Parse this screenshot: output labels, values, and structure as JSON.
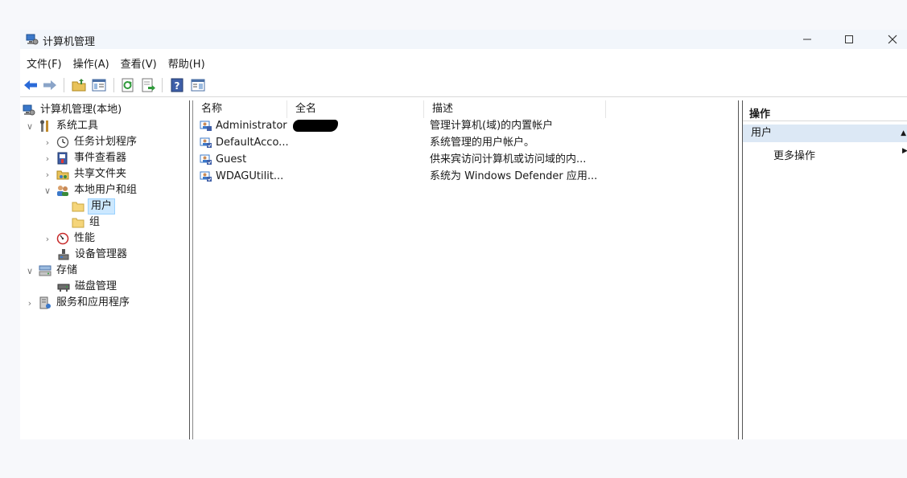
{
  "window": {
    "title": "计算机管理"
  },
  "menu": [
    "文件(F)",
    "操作(A)",
    "查看(V)",
    "帮助(H)"
  ],
  "tree": [
    {
      "label": "计算机管理(本地)",
      "icon": "computer-management-icon",
      "twisty": ""
    },
    {
      "label": "系统工具",
      "icon": "system-tools-icon",
      "twisty": "∨"
    },
    {
      "label": "任务计划程序",
      "icon": "task-scheduler-icon",
      "twisty": "›"
    },
    {
      "label": "事件查看器",
      "icon": "event-viewer-icon",
      "twisty": "›"
    },
    {
      "label": "共享文件夹",
      "icon": "shared-folders-icon",
      "twisty": "›"
    },
    {
      "label": "本地用户和组",
      "icon": "local-users-icon",
      "twisty": "∨"
    },
    {
      "label": "用户",
      "icon": "folder-icon",
      "twisty": ""
    },
    {
      "label": "组",
      "icon": "folder-icon",
      "twisty": ""
    },
    {
      "label": "性能",
      "icon": "performance-icon",
      "twisty": "›"
    },
    {
      "label": "设备管理器",
      "icon": "device-manager-icon",
      "twisty": ""
    },
    {
      "label": "存储",
      "icon": "storage-icon",
      "twisty": "∨"
    },
    {
      "label": "磁盘管理",
      "icon": "disk-management-icon",
      "twisty": ""
    },
    {
      "label": "服务和应用程序",
      "icon": "services-icon",
      "twisty": "›"
    }
  ],
  "list": {
    "columns": [
      "名称",
      "全名",
      "描述"
    ],
    "rows": [
      {
        "name": "Administrator",
        "fullname": "",
        "description": "管理计算机(域)的内置帐户"
      },
      {
        "name": "DefaultAcco...",
        "fullname": "",
        "description": "系统管理的用户帐户。"
      },
      {
        "name": "Guest",
        "fullname": "",
        "description": "供来宾访问计算机或访问域的内..."
      },
      {
        "name": "WDAGUtilit...",
        "fullname": "",
        "description": "系统为 Windows Defender 应用..."
      }
    ]
  },
  "actions": {
    "header": "操作",
    "section": "用户",
    "more": "更多操作"
  },
  "colors": {
    "selection": "#cce8ff",
    "action_section": "#dce8f5",
    "back_arrow": "#2a6ad8"
  }
}
